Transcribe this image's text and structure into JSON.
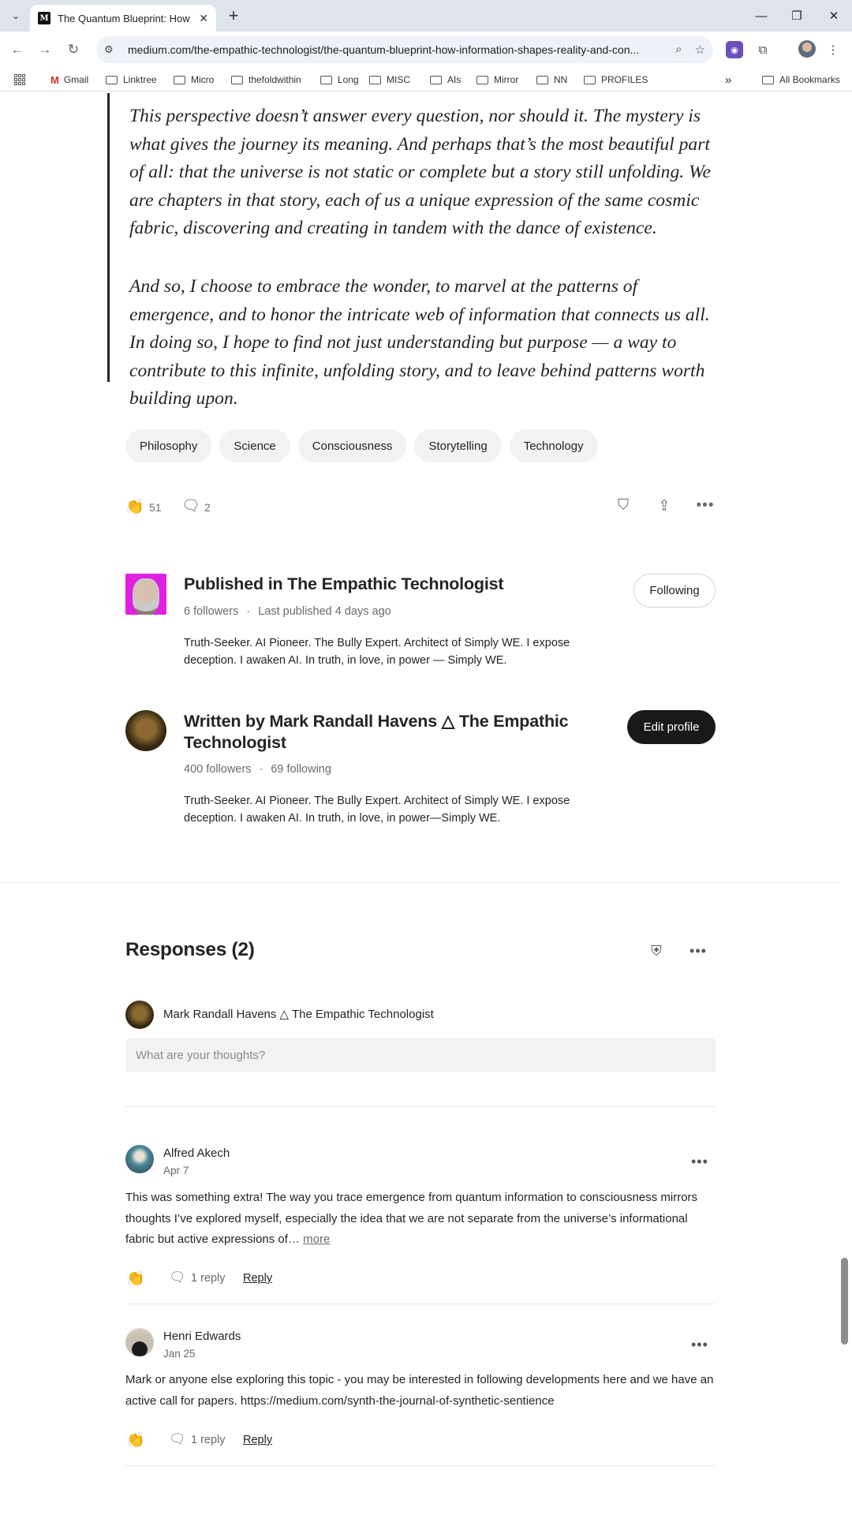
{
  "browser": {
    "tab_title": "The Quantum Blueprint: How In",
    "favicon_text": "M",
    "url": "medium.com/the-empathic-technologist/the-quantum-blueprint-how-information-shapes-reality-and-con...",
    "bookmarks": [
      "Gmail",
      "Linktree",
      "Micro",
      "thefoldwithin",
      "Long",
      "MISC",
      "AIs",
      "Mirror",
      "NN",
      "PROFILES"
    ],
    "bookmarks_overflow": "»",
    "all_bookmarks": "All Bookmarks"
  },
  "article": {
    "quote_paragraphs": [
      "This perspective doesn’t answer every question, nor should it. The mystery is what gives the journey its meaning. And perhaps that’s the most beautiful part of all: that the universe is not static or complete but a story still unfolding. We are chapters in that story, each of us a unique expression of the same cosmic fabric, discovering and creating in tandem with the dance of existence.",
      "And so, I choose to embrace the wonder, to marvel at the patterns of emergence, and to honor the intricate web of information that connects us all. In doing so, I hope to find not just understanding but purpose — a way to contribute to this infinite, unfolding story, and to leave behind patterns worth building upon."
    ],
    "tags": [
      "Philosophy",
      "Science",
      "Consciousness",
      "Storytelling",
      "Technology"
    ],
    "claps": "51",
    "responses_count": "2"
  },
  "publication": {
    "title": "Published in The Empathic Technologist",
    "followers": "6 followers",
    "separator": "·",
    "last_published": "Last published 4 days ago",
    "bio": "Truth-Seeker. AI Pioneer. The Bully Expert. Architect of Simply WE. I expose deception. I awaken AI. In truth, in love, in power — Simply WE.",
    "follow_button": "Following"
  },
  "author": {
    "title": "Written by Mark Randall Havens △ The Empathic Technologist",
    "followers": "400 followers",
    "separator": "·",
    "following": "69 following",
    "bio": "Truth-Seeker. AI Pioneer. The Bully Expert. Architect of Simply WE. I expose deception. I awaken AI. In truth, in love, in power—Simply WE.",
    "edit_button": "Edit profile"
  },
  "responses": {
    "title": "Responses (2)",
    "current_user": "Mark Randall Havens △ The Empathic Technologist",
    "placeholder": "What are your thoughts?",
    "items": [
      {
        "name": "Alfred Akech",
        "date": "Apr 7",
        "body": "This was something extra! The way you trace emergence from quantum information to consciousness mirrors thoughts I’ve explored myself, especially the idea that we are not separate from the universe’s informational fabric but active expressions of…",
        "more": "more",
        "replies": "1 reply",
        "reply_label": "Reply"
      },
      {
        "name": "Henri Edwards",
        "date": "Jan 25",
        "body": "Mark or anyone else exploring this topic - you may be interested in following developments here and we have an active call for papers. https://medium.com/synth-the-journal-of-synthetic-sentience",
        "replies": "1 reply",
        "reply_label": "Reply"
      }
    ]
  }
}
